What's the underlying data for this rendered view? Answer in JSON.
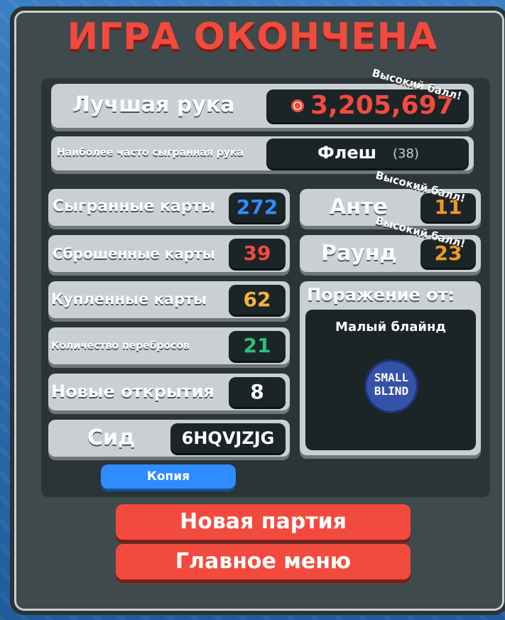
{
  "title": "ИГРА ОКОНЧЕНА",
  "best_hand": {
    "label": "Лучшая рука",
    "value": "3,205,697",
    "badge": "Высокий балл!"
  },
  "most_played": {
    "label": "Наиболее часто сыгранная рука",
    "hand": "Флеш",
    "count": "(38)"
  },
  "stats": [
    {
      "label": "Сыгранные карты",
      "value": "272",
      "color": "#2f8cff"
    },
    {
      "label": "Сброшенные карты",
      "value": "39",
      "color": "#f24b3e"
    },
    {
      "label": "Купленные карты",
      "value": "62",
      "color": "#f3b53c"
    },
    {
      "label": "Количество перебросов",
      "value": "21",
      "color": "#2fbf7a"
    },
    {
      "label": "Новые открытия",
      "value": "8",
      "color": "#ffffff"
    }
  ],
  "seed": {
    "label": "Сид",
    "value": "6HQVJZJG"
  },
  "copy_label": "Копия",
  "ante": {
    "label": "Анте",
    "value": "11",
    "badge": "Высокий балл!"
  },
  "round": {
    "label": "Раунд",
    "value": "23",
    "badge": "Высокий балл!"
  },
  "defeat": {
    "title": "Поражение от:",
    "name": "Малый блайнд",
    "chip_text_1": "SMALL",
    "chip_text_2": "BLIND"
  },
  "buttons": {
    "new_game": "Новая партия",
    "main_menu": "Главное меню"
  }
}
